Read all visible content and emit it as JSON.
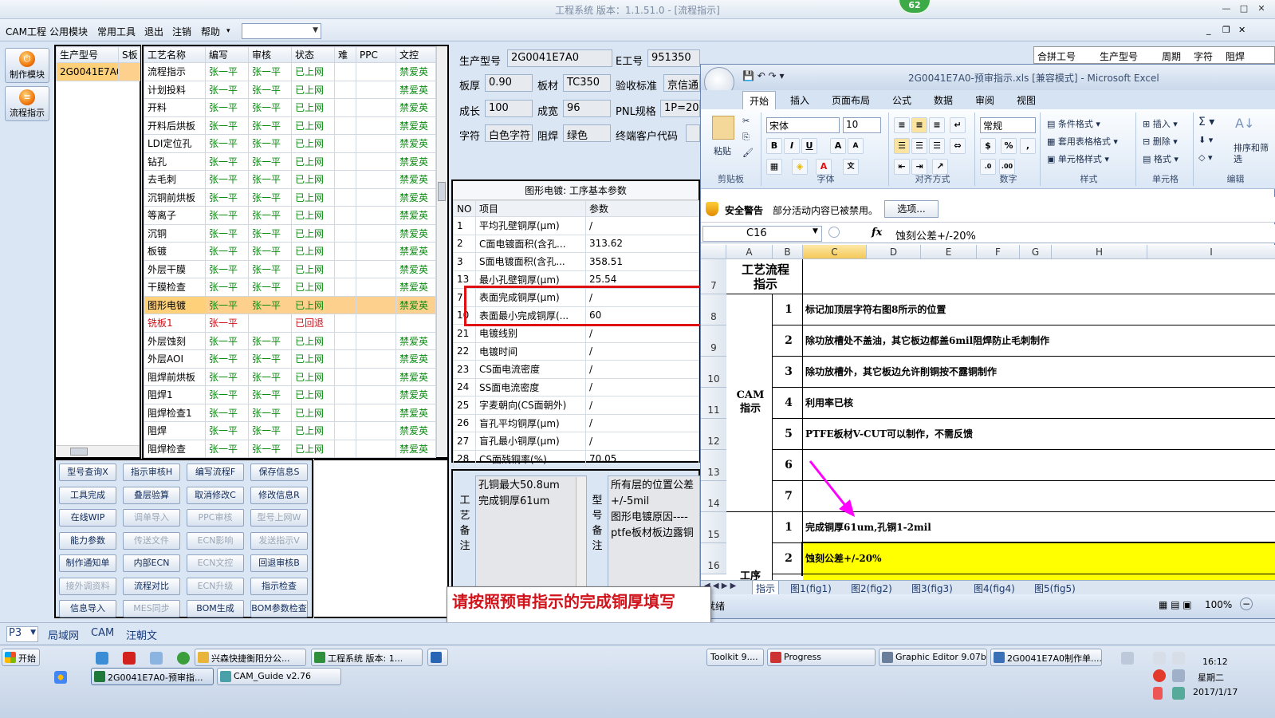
{
  "app": {
    "title": "工程系统   版本：1.1.51.0 - [流程指示]",
    "badge": "62"
  },
  "menu": {
    "items": [
      "CAM工程",
      "公用模块",
      "常用工具",
      "退出",
      "注销",
      "帮助"
    ]
  },
  "leftnav": {
    "items": [
      "制作模块",
      "流程指示"
    ]
  },
  "orders": {
    "headers": [
      "生产型号",
      "S板"
    ],
    "rows": [
      "2G0041E7A0"
    ]
  },
  "process": {
    "headers": [
      "工艺名称",
      "编写",
      "审核",
      "状态",
      "难",
      "PPC",
      "文控"
    ],
    "rows": [
      {
        "name": "流程指示",
        "writer": "张一平",
        "reviewer": "张一平",
        "status": "已上网",
        "doc": "禁爱英"
      },
      {
        "name": "计划投料",
        "writer": "张一平",
        "reviewer": "张一平",
        "status": "已上网",
        "doc": "禁爱英"
      },
      {
        "name": "开料",
        "writer": "张一平",
        "reviewer": "张一平",
        "status": "已上网",
        "doc": "禁爱英"
      },
      {
        "name": "开料后烘板",
        "writer": "张一平",
        "reviewer": "张一平",
        "status": "已上网",
        "doc": "禁爱英"
      },
      {
        "name": "LDI定位孔",
        "writer": "张一平",
        "reviewer": "张一平",
        "status": "已上网",
        "doc": "禁爱英"
      },
      {
        "name": "钻孔",
        "writer": "张一平",
        "reviewer": "张一平",
        "status": "已上网",
        "doc": "禁爱英"
      },
      {
        "name": "去毛刺",
        "writer": "张一平",
        "reviewer": "张一平",
        "status": "已上网",
        "doc": "禁爱英"
      },
      {
        "name": "沉铜前烘板",
        "writer": "张一平",
        "reviewer": "张一平",
        "status": "已上网",
        "doc": "禁爱英"
      },
      {
        "name": "等离子",
        "writer": "张一平",
        "reviewer": "张一平",
        "status": "已上网",
        "doc": "禁爱英"
      },
      {
        "name": "沉铜",
        "writer": "张一平",
        "reviewer": "张一平",
        "status": "已上网",
        "doc": "禁爱英"
      },
      {
        "name": "板镀",
        "writer": "张一平",
        "reviewer": "张一平",
        "status": "已上网",
        "doc": "禁爱英"
      },
      {
        "name": "外层干膜",
        "writer": "张一平",
        "reviewer": "张一平",
        "status": "已上网",
        "doc": "禁爱英"
      },
      {
        "name": "干膜检查",
        "writer": "张一平",
        "reviewer": "张一平",
        "status": "已上网",
        "doc": "禁爱英"
      },
      {
        "name": "图形电镀",
        "writer": "张一平",
        "reviewer": "张一平",
        "status": "已上网",
        "doc": "禁爱英",
        "selected": true
      },
      {
        "name": "铣板1",
        "writer": "张一平",
        "reviewer": "",
        "status": "已回退",
        "doc": "",
        "red": true
      },
      {
        "name": "外层蚀刻",
        "writer": "张一平",
        "reviewer": "张一平",
        "status": "已上网",
        "doc": "禁爱英"
      },
      {
        "name": "外层AOI",
        "writer": "张一平",
        "reviewer": "张一平",
        "status": "已上网",
        "doc": "禁爱英"
      },
      {
        "name": "阻焊前烘板",
        "writer": "张一平",
        "reviewer": "张一平",
        "status": "已上网",
        "doc": "禁爱英"
      },
      {
        "name": "阻焊1",
        "writer": "张一平",
        "reviewer": "张一平",
        "status": "已上网",
        "doc": "禁爱英"
      },
      {
        "name": "阻焊检查1",
        "writer": "张一平",
        "reviewer": "张一平",
        "status": "已上网",
        "doc": "禁爱英"
      },
      {
        "name": "阻焊",
        "writer": "张一平",
        "reviewer": "张一平",
        "status": "已上网",
        "doc": "禁爱英"
      },
      {
        "name": "阻焊检查",
        "writer": "张一平",
        "reviewer": "张一平",
        "status": "已上网",
        "doc": "禁爱英"
      }
    ]
  },
  "buttons": [
    {
      "label": "型号查询X",
      "enabled": true
    },
    {
      "label": "指示审核H",
      "enabled": true
    },
    {
      "label": "编写流程F",
      "enabled": true
    },
    {
      "label": "保存信息S",
      "enabled": true
    },
    {
      "label": "工具完成",
      "enabled": true
    },
    {
      "label": "叠层验算",
      "enabled": true
    },
    {
      "label": "取消修改C",
      "enabled": true
    },
    {
      "label": "修改信息R",
      "enabled": true
    },
    {
      "label": "在线WIP",
      "enabled": true
    },
    {
      "label": "调单导入",
      "enabled": false
    },
    {
      "label": "PPC审核",
      "enabled": false
    },
    {
      "label": "型号上网W",
      "enabled": false
    },
    {
      "label": "能力参数",
      "enabled": true
    },
    {
      "label": "传送文件",
      "enabled": false
    },
    {
      "label": "ECN影响",
      "enabled": false
    },
    {
      "label": "发送指示V",
      "enabled": false
    },
    {
      "label": "制作通知单",
      "enabled": true
    },
    {
      "label": "内部ECN",
      "enabled": true
    },
    {
      "label": "ECN文控",
      "enabled": false
    },
    {
      "label": "回退审核B",
      "enabled": true
    },
    {
      "label": "接外调资料",
      "enabled": false
    },
    {
      "label": "流程对比",
      "enabled": true
    },
    {
      "label": "ECN升级",
      "enabled": false
    },
    {
      "label": "指示检查",
      "enabled": true
    },
    {
      "label": "信息导入",
      "enabled": true
    },
    {
      "label": "MES同步",
      "enabled": false
    },
    {
      "label": "BOM生成",
      "enabled": true
    },
    {
      "label": "BOM参数检查",
      "enabled": true
    }
  ],
  "info": {
    "model_label": "生产型号",
    "model": "2G0041E7A0",
    "eno_label": "E工号",
    "eno": "951350",
    "thick_label": "板厚",
    "thick": "0.90",
    "mat_label": "板材",
    "mat": "TC350",
    "std_label": "验收标准",
    "std": "京信通",
    "len_label": "成长",
    "len": "100",
    "wid_label": "成宽",
    "wid": "96",
    "pnl_label": "PNL规格",
    "pnl": "1P=20",
    "char_label": "字符",
    "char": "白色字符",
    "mask_label": "阻焊",
    "mask": "绿色",
    "cust_label": "终端客户代码"
  },
  "params": {
    "title": "图形电镀: 工序基本参数",
    "headers": [
      "NO",
      "项目",
      "参数"
    ],
    "rows": [
      {
        "no": "1",
        "item": "平均孔壁铜厚(μm)",
        "val": "/"
      },
      {
        "no": "2",
        "item": "C面电镀面积(含孔...",
        "val": "313.62"
      },
      {
        "no": "3",
        "item": "S面电镀面积(含孔...",
        "val": "358.51"
      },
      {
        "no": "13",
        "item": "最小孔壁铜厚(μm)",
        "val": "25.54"
      },
      {
        "no": "7",
        "item": "表面完成铜厚(μm)",
        "val": "/"
      },
      {
        "no": "10",
        "item": "表面最小完成铜厚(...",
        "val": "60"
      },
      {
        "no": "21",
        "item": "电镀线别",
        "val": "/"
      },
      {
        "no": "22",
        "item": "电镀时间",
        "val": "/"
      },
      {
        "no": "23",
        "item": "CS面电流密度",
        "val": "/"
      },
      {
        "no": "24",
        "item": "SS面电流密度",
        "val": "/"
      },
      {
        "no": "25",
        "item": "字麦朝向(CS面朝外)",
        "val": "/"
      },
      {
        "no": "26",
        "item": "盲孔平均铜厚(μm)",
        "val": "/"
      },
      {
        "no": "27",
        "item": "盲孔最小铜厚(μm)",
        "val": "/"
      },
      {
        "no": "28",
        "item": "CS面残铜率(%)",
        "val": "70.05"
      }
    ]
  },
  "notes": {
    "proc_label": "工艺备注",
    "proc_text": "孔铜最大50.8um\n完成铜厚61um",
    "model_label": "型号备注",
    "model_text": "所有层的位置公差\n+/-5mil\n图形电镀原因----\nptfe板材板边露铜"
  },
  "tooltip": "请按照预审指示的完成铜厚填写",
  "right_grid_headers": [
    "合拼工号",
    "生产型号",
    "周期",
    "字符",
    "阻焊"
  ],
  "excel": {
    "title": "2G0041E7A0-预审指示.xls [兼容模式] - Microsoft Excel",
    "tabs": [
      "开始",
      "插入",
      "页面布局",
      "公式",
      "数据",
      "审阅",
      "视图"
    ],
    "font": "宋体",
    "size": "10",
    "numfmt": "常规",
    "groups": [
      "剪贴板",
      "字体",
      "对齐方式",
      "数字",
      "样式",
      "单元格",
      "编辑"
    ],
    "ribbon": {
      "paste": "粘贴",
      "cond": "条件格式",
      "table": "套用表格格式",
      "cellstyle": "单元格样式",
      "insert": "插入",
      "delete": "删除",
      "format": "格式",
      "sort": "排序和筛选"
    },
    "security_label": "安全警告",
    "security_text": "部分活动内容已被禁用。",
    "options": "选项...",
    "namebox": "C16",
    "formula": "蚀刻公差+/-20%",
    "cols": [
      "A",
      "B",
      "C",
      "D",
      "E",
      "F",
      "G",
      "H",
      "I"
    ],
    "header_cell": "工艺流程\n指示",
    "section_label": "CAM\n指示",
    "section2_label": "工序",
    "rows_cam": [
      {
        "n": "1",
        "text": "标记加顶层字符右图8所示的位置"
      },
      {
        "n": "2",
        "text": "除功放槽处不盖油，其它板边都盖6mil阻焊防止毛刺制作"
      },
      {
        "n": "3",
        "text": "除功放槽外，其它板边允许削铜按不露铜制作"
      },
      {
        "n": "4",
        "text": "利用率已核"
      },
      {
        "n": "5",
        "text": "PTFE板材V-CUT可以制作，不需反馈"
      },
      {
        "n": "6",
        "text": ""
      },
      {
        "n": "7",
        "text": ""
      }
    ],
    "rows_proc": [
      {
        "n": "1",
        "text": "完成铜厚61um,孔铜1-2mil"
      },
      {
        "n": "2",
        "text": "蚀刻公差+/-20%"
      }
    ],
    "row_numbers": [
      "7",
      "8",
      "9",
      "10",
      "11",
      "12",
      "13",
      "14",
      "15",
      "16"
    ],
    "sheets": [
      "指示",
      "图1(fig1)",
      "图2(fig2)",
      "图3(fig3)",
      "图4(fig4)",
      "图5(fig5)"
    ],
    "status_ready": "就绪",
    "zoom": "100%"
  },
  "statusbar": {
    "combo": "P3",
    "items": [
      "局域网",
      "CAM",
      "汪朝文"
    ]
  },
  "taskbar": {
    "start": "开始",
    "row1": [
      "兴森快捷衡阳分公...",
      "工程系统 版本: 1...",
      "Toolkit 9....",
      "Progress",
      "Graphic Editor 9.07b...",
      "2G0041E7A0制作单...."
    ],
    "row2": [
      "2G0041E7A0-预审指...",
      "CAM_Guide v2.76"
    ],
    "time": "16:12",
    "weekday": "星期二",
    "date": "2017/1/17"
  },
  "colors": {
    "accent": "#3caa46",
    "selected_row": "#fdd08e",
    "highlight": "#ffff00",
    "red": "#e01010",
    "arrow": "#ff00ff"
  }
}
